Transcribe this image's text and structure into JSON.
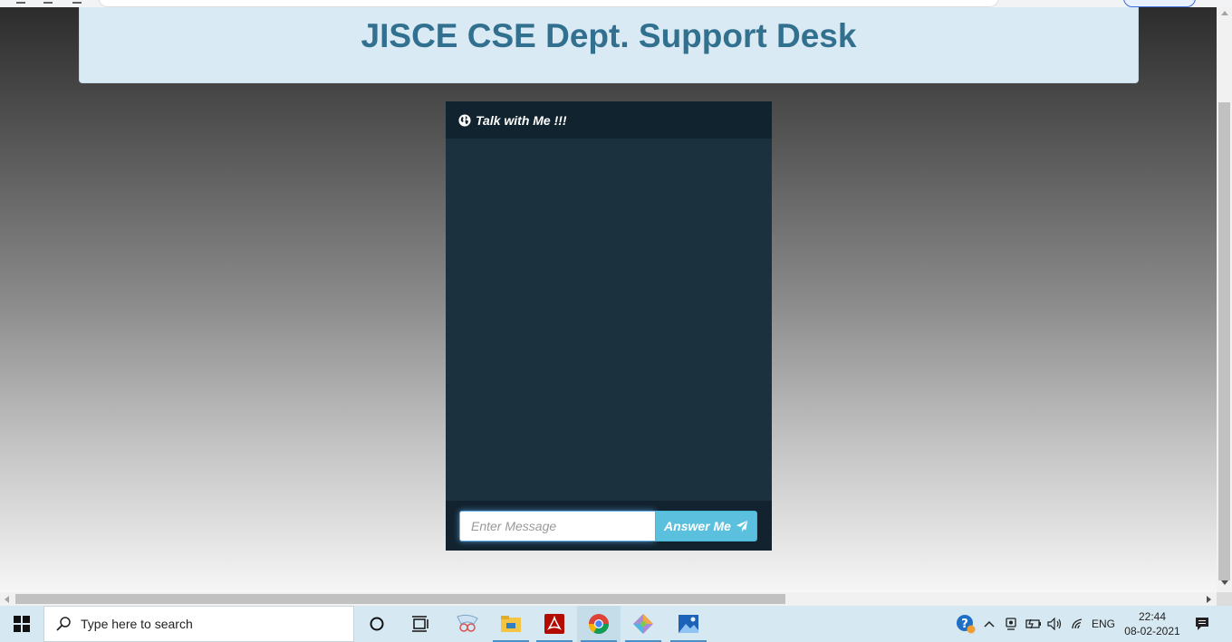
{
  "page": {
    "title": "JISCE CSE Dept. Support Desk"
  },
  "chat": {
    "heading": "Talk with Me !!!",
    "input_placeholder": "Enter Message",
    "send_label": "Answer Me"
  },
  "taskbar": {
    "search_placeholder": "Type here to search",
    "pinned": [
      "cortana-icon",
      "task-view-icon",
      "snipping-tool-icon",
      "file-explorer-icon",
      "acrobat-icon",
      "chrome-icon",
      "paint-3d-icon",
      "photos-icon"
    ],
    "active_app": "chrome-icon",
    "language": "ENG",
    "time": "22:44",
    "date": "08-02-2021"
  },
  "colors": {
    "title": "#31708f",
    "banner": "#d9eaf4",
    "chat_panel": "#1c313e",
    "chat_header": "#11232f",
    "send_button": "#5bc0de",
    "taskbar": "#d6e8f2"
  }
}
